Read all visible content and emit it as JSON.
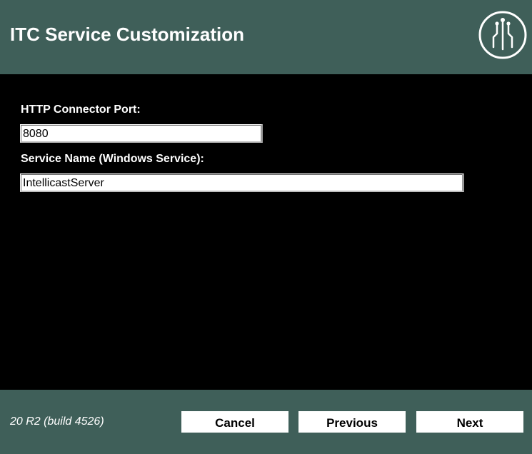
{
  "header": {
    "title": "ITC Service Customization",
    "logo_icon": "circuit-logo-icon"
  },
  "form": {
    "port_label": "HTTP Connector Port:",
    "port_value": "8080",
    "service_label": "Service Name (Windows Service):",
    "service_value": "IntellicastServer"
  },
  "footer": {
    "version": "20 R2 (build 4526)",
    "cancel_label": "Cancel",
    "previous_label": "Previous",
    "next_label": "Next"
  },
  "colors": {
    "header_bg": "#3f5f59",
    "content_bg": "#000000",
    "text": "#ffffff",
    "button_bg": "#ffffff"
  }
}
